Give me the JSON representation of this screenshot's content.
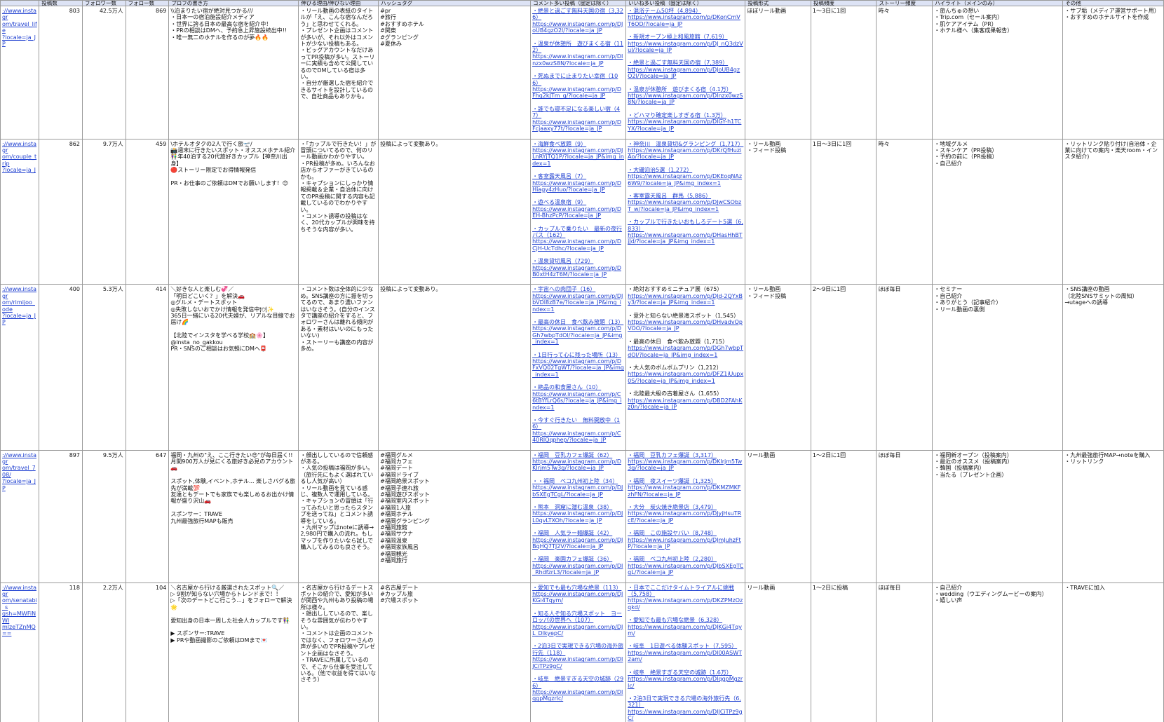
{
  "headers": [
    "",
    "投稿数",
    "フォロワー数",
    "フォロー数",
    "プロフの書き方",
    "伸びる理由/伸びない理由",
    "ハッシュタグ",
    "コメント多い投稿（固定は除く）",
    "いいね多い投稿（固定は除く）",
    "投稿形式",
    "投稿頻度",
    "ストーリー頻度",
    "ハイライト（メインのみ）",
    "その他"
  ],
  "rows": [
    {
      "url": "://www.instagr\nom/travel_life\n?locale=ja_JP",
      "posts": "803",
      "followers": "42.5万人",
      "following": "869",
      "profile": "\\\\泊まりたい宿が絶対見つかる///\n・日本一の宿泊施設紹介メディア\n・世界に誇る日本の最高な宿を紹介中！\n・PRの相談はDMへ、予約急上昇施設続出中!!\n・唯一無二のホテルを作るのが夢🔥🔥",
      "reason": "・リール動画の表紙のタイトルが「え、こんな宿なんだろう」と思わせてくれる。\n・プレゼント企画はコメントが多いが、それ以外はコメントが少ない投稿もある。\n・ビッグアカウントなだけあってPR投稿が多い。ストーリーに実績も含めて公開しているのでDMしている宿は多い。\n・自分が厳選した宿を紹介できるサイトを設計しているので、自社商品もありかも。",
      "hashtags": "#pr\n#旅行\n#おすすめホテル\n#関東\n#グランピング\n#夏休み",
      "comment_posts": [
        {
          "title": "・絶景と過ごす無料天国の宿（3,326）",
          "url": "https://www.instagram.com/p/DJoUB4gzO2l/?locale=ja_JP"
        },
        {
          "title": "・温泉が休憩所　遊びまくる宿（112）",
          "url": "https://www.instagram.com/p/DInzx0wzS8N/?locale=ja_JP"
        },
        {
          "title": "・死ぬまでに止まりたい幸宿（106）",
          "url": "https://www.instagram.com/p/DFhq2kJTm_g/?locale=ja_JP"
        },
        {
          "title": "・誰でも寝不足になる楽しい宿（47）",
          "url": "https://www.instagram.com/p/DFcjaaxy77t/?locale=ja_JP"
        }
      ],
      "like_posts": [
        {
          "title": "・混浴テーム50坪（4,894）",
          "url": "https://www.instagram.com/p/DKonCmVT6OD/?locale=ja_JP"
        },
        {
          "title": "・新規オープン極上和風旅館（7,619）",
          "url": "https://www.instagram.com/p/DJ_nQ3dzVul/?locale=ja_JP"
        },
        {
          "title": "・絶景と過ごす無料天国の宿（7,389）",
          "url": "https://www.instagram.com/p/DJoUB4gzO2l/?locale=ja_JP"
        },
        {
          "title": "・温泉が休憩所　遊びまくる宿（4.1万）",
          "url": "https://www.instagram.com/p/DInzx0wzS8N/?locale=ja_JP"
        },
        {
          "title": "・どハマり確定楽しすぎる宿（1.3万）",
          "url": "https://www.instagram.com/p/DIGY-h1TCYX/?locale=ja_JP"
        }
      ],
      "format": "ほぼリール動画",
      "frequency": "1〜3日に1回",
      "story": "時々",
      "highlight": "・旅んちゅの想い\n・Trip.com（セール案内）\n・肌ケアアイテム（PR）\n・ホテル様へ（集客成果報告）",
      "other": "・サブ垢（メディア運営サポート用）\n・おすすめのホテルサイトを作成"
    },
    {
      "url": "://www.instagr\nom/couple_trip\n?locale=ja_J",
      "posts": "862",
      "followers": "9.7万人",
      "following": "459",
      "profile": "\\ホテルオタクの2人で行く旅🛫/\n📸週末に行きたいスポット・オススメホテル紹介\n👫年40泊する20代旅好きカップル【神奈川出身】\n🔴ストーリー限定でお得情報発信\n\nPR・お仕事のご依頼はDMでお願いします！😊",
      "reason": "・「カップルで行きたい！」が冒頭についてるので、何のリール動画かわかりやすい。\n・PR投稿が多め。いろんなお店からオファーがきているのかも。\n・キャプションにしっかり情報掲載＆企業・自治体に向けてのPR投稿に関する内容も記載しているのでわかりやすい。\n・コメント誘導の投稿はなく、20代カップルが興味を持ちそうな内容が多い。",
      "hashtags": "投稿によって変動あり。",
      "comment_posts": [
        {
          "title": "・海鮮食べ放題（9）",
          "url": "https://www.instagram.com/p/DJLnRYjTQ1P/?locale=ja_JP&img_index=1"
        },
        {
          "title": "・客室露天風呂（7）",
          "url": "https://www.instagram.com/p/DHiagy4zHuo/?locale=ja_JP"
        },
        {
          "title": "・遊べる温泉宿（9）",
          "url": "https://www.instagram.com/p/DEH-BhzPcP/?locale=ja_JP"
        },
        {
          "title": "・カップルで乗りたい　最新の夜行バス（162）",
          "url": "https://www.instagram.com/p/DCjH-UcTdhc/?locale=ja_JP"
        },
        {
          "title": "・温泉貸切風呂（729）",
          "url": "https://www.instagram.com/p/DB0xtH4zT6M/?locale=ja_JP"
        }
      ],
      "like_posts": [
        {
          "title": "・神奈川　温泉貸切&グランピング（1,717）",
          "url": "https://www.instagram.com/p/DKrQfHuziAo/?locale=ja_JP"
        },
        {
          "title": "・大磯泊治5選（1,272）",
          "url": "https://www.instagram.com/p/DKEoqNAz6W9/?locale=ja_JP&img_index=1"
        },
        {
          "title": "・客室露天風呂　群馬（5,886）",
          "url": "https://www.instagram.com/p/DJwCSObzT_w/?locale=ja_JP&img_index=1"
        },
        {
          "title": "・カップルで行きたいおもしろデート5選（6,833）",
          "url": "https://www.instagram.com/p/DHasHhBTjJd/?locale=ja_JP&img_index=1"
        }
      ],
      "format": "・リール動画\n・フィード投稿",
      "frequency": "1日〜3日に1回",
      "story": "時々",
      "highlight": "・地域グルメ\n・スキンケア（PR投稿）\n・予約の前に（PR投稿）\n・自己紹介",
      "other": "・リットリンク貼り付け(自治体・企業に向けての案内・楽天room・インスタ紹介)"
    },
    {
      "url": "://www.instagr\nom/rimijoo_ode\n?locale=ja_JP",
      "posts": "400",
      "followers": "5.3万人",
      "following": "414",
      "profile": "＼好きな人と楽しむ💞／\n「明日どこいく？」を解決🚗\n◎グルメ・デートスポット\n◎失敗しないおでかけ情報を発信中🍽✨\n365日一緒にいる20代夫婦が、リアルな目線でお届け🌈\n\n【北陸でインスタを学べる学校🏫🌸】\n@insta_no_gakkou\nPR・SNSのご相談はお気軽にDMへ📮",
      "reason": "・コメント数は全体的に少なめ。SNS講座の方に振を切ってるので、あまり濃いファンはいなさそう。(自分のインスタで講座の紹介をすると、フォロワーさんは離れる傾向がある・素材はいいのにもったいない)\n・ストーリーも講座の内容が多め。",
      "hashtags": "投稿によって変動あり。",
      "comment_posts": [
        {
          "title": "・宇宙への肉団子（16）",
          "url": "https://www.instagram.com/p/DJbVDl8zB7e/?locale=ja_JP&img_index=1"
        },
        {
          "title": "・最高の休日　食べ飲み放題（13）",
          "url": "https://www.instagram.com/p/DGh7wbpTdOl/?locale=ja_JP&img_index=1"
        },
        {
          "title": "・1日行って心に残った場所（13）",
          "url": "https://www.instagram.com/p/DFxVQ02TgWT/?locale=ja_JP&img_index=1"
        },
        {
          "title": "・絶品の和食屋さん（10）",
          "url": "https://www.instagram.com/p/C6tBYfLrQ6s/?locale=ja_JP&img_index=1"
        },
        {
          "title": "・今すぐ行きたい　無料開放中（16）",
          "url": "https://www.instagram.com/p/C40RIQqphep/?locale=ja_JP"
        }
      ],
      "like_posts": [
        {
          "title": "・絶対おすすめミニチュア展（675）",
          "url": "https://www.instagram.com/p/DJd-2QYxBy3/?locale=ja_JP&img_index=1",
          "plain": true
        },
        {
          "title": "・意外と知らない絶景滝スポット（1,545）",
          "url": "https://www.instagram.com/p/DHvadvOpVOO/?locale=ja_JP",
          "plain": true
        },
        {
          "title": "・最高の休日　食べ飲み放題（1,715）",
          "url": "https://www.instagram.com/p/DGh7wbpTdOl/?locale=ja_JP&img_index=1",
          "plain": true
        },
        {
          "title": "・大人気のボムボムプリン（1,212）",
          "url": "https://www.instagram.com/p/DFZ1iUupx0S/?locale=ja_JP&img_index=1",
          "plain": true
        },
        {
          "title": "・北陸最大級の古着屋さん（1,655）",
          "url": "https://www.instagram.com/p/DBD2FAhKz0n/?locale=ja_JP",
          "plain": true
        }
      ],
      "format": "・リール動画\n・フィード投稿",
      "frequency": "2〜9日に1回",
      "story": "ほぼ毎日",
      "highlight": "・セミナー\n・自己紹介\n・ありがとう（記事紹介）\n・リール動画の裏側",
      "other": "・SNS講座の動画\n（北陸SNSサミットの周知）\n→utageへの誘導"
    },
    {
      "url": "://www.instagr\nom/travel_708/\n?locale=ja_JP",
      "posts": "897",
      "followers": "9.5万人",
      "following": "647",
      "profile": "福岡・九州の\"え、ここ行きたい😍\"が毎日届く!!\n月間900万人が見にくる旅好き必見のアカウント🚗\n\nスポット,体験,イベント,ホテル... 楽しさバグる旅先が満載💯\n友達ともデートでも家族でも楽しめるお出かけ情報が盛り沢山🚗\n\nスポンサー：TRAVE\n九州最強旅行MAPも販売",
      "reason": "・顔出ししているので信頼感がある。\n・人気の投稿は福岡が多い。（旅行先にもよく選ばれているし人気が高い）\n・リール動画を見ている感じ、複数人で運用している。\n・キャプションの冒頭は「行ってみたいと思ったらスタンプを送ってね」とコメント誘導をしている。\n・九州マップはnoteに誘導→2,980円で購入の流れ。もしマップを作りたいなら試しで購入してみるのも良さそう。",
      "hashtags": "#福岡グルメ\n#福岡カフェ\n#福岡デート\n#福岡ドライブ\n#福岡絶景スポット\n#福岡子連れ旅\n#福岡遊びスポット\n#福岡室内スポット\n#福岡1人旅\n#福岡ホテル\n#福岡グランピング\n#福岡旅館\n#福岡サウナ\n#福岡温泉\n#福岡家族風呂\n#福岡観光\n#福岡旅行",
      "comment_posts": [
        {
          "title": "・福岡　豆乳カフェ爆誕（62）",
          "url": "https://www.instagram.com/p/DKIrjm5Tw3g/?locale=ja_JP"
        },
        {
          "title": "・・福岡　ペコ九州初上陸（34）",
          "url": "https://www.instagram.com/p/DJbSXEgTCgL/?locale=ja_JP"
        },
        {
          "title": "・熊本　洞窟に潜む温泉（38）",
          "url": "https://www.instagram.com/p/DJL0qvLTXOh/?locale=ja_JP"
        },
        {
          "title": "・福岡　人気ラー麺爆誕（42）",
          "url": "https://www.instagram.com/p/DJBqHQ7TJ2V/?locale=ja_JP"
        },
        {
          "title": "・福岡　楽園カフェ爆誕（36）",
          "url": "https://www.instagram.com/p/DI_RhdfzrL3/?locale=ja_JP"
        }
      ],
      "like_posts": [
        {
          "title": "・福岡　豆乳カフェ爆誕（3,317）",
          "url": "https://www.instagram.com/p/DKIrjm5Tw3g/?locale=ja_JP"
        },
        {
          "title": "・福岡　夜スイーツ爆誕（1,325）",
          "url": "https://www.instagram.com/p/DKMZMKFzhFN/?locale=ja_JP"
        },
        {
          "title": "・大分　炭火焼き絶景店（3,479）",
          "url": "https://www.instagram.com/p/DJyjHsuTRcE/?locale=ja_JP"
        },
        {
          "title": "・福岡　この施設ヤバい（8,748）",
          "url": "https://www.instagram.com/p/DJmJuhzFtP/?locale=ja_JP"
        },
        {
          "title": "・福岡　ペコ九州初上陸（2,280）",
          "url": "https://www.instagram.com/p/DJbSXEgTCgL/?locale=ja_JP"
        }
      ],
      "format": "リール動画",
      "frequency": "1〜2日に1回",
      "story": "ほぼ毎日",
      "highlight": "・福岡新オープン（投稿案内）\n・最近のオススメ（投稿案内）\n・韓国（投稿案内）\n・当たる（プレゼント企画）",
      "other": "・九州最強旅行MAP→noteを購入\n・リットリンク"
    },
    {
      "url": "://www.instagr\nom/senatabi_s\ngsh=MWFiNWI\nmlzeTZnMQ==",
      "posts": "118",
      "followers": "2.2万人",
      "following": "104",
      "profile": "＼名古屋から行ける厳選されたスポット🔍／\n▷ 9割が知らない穴場からトレンドまで！！\n▷「次のデートどこ行こう...」をフォローで解決🌟\n\n愛知出身の日本一周した社会人カップルです👫\n\n▶ スポンサー:TRAVE\n▶ PRや動画撮影のご依頼はDMまで💌",
      "reason": "・名古屋から行けるデートスポットの紹介で、愛知が多いが関西や九州もあり投稿の場所は様々。\n・顔出ししているので、楽しそうな雰囲気が伝わりやすい。\n・コメントは企画のコメントではなく、フォロワーさんの声が多いのでPR投稿やプレゼント企画はなさそう。\n・TRAVEに所属しているので、そこから仕事を受注している。（他で収益を得てはいなさそう）",
      "hashtags": "#名古屋デート\n#カップル旅\n#穴場スポット",
      "comment_posts": [
        {
          "title": "・愛知でも最も穴場な絶景（113）",
          "url": "https://www.instagram.com/p/DJKGi4Tqym/"
        },
        {
          "title": "・知る人ぞ知る穴場スポット　ヨーロッパの世界へ（107）",
          "url": "https://www.instagram.com/p/DJL_DlkyepC/"
        },
        {
          "title": "・2泊3日で実現できる穴場の海外旅行先（118）",
          "url": "https://www.instagram.com/p/DIJCiTPz9gC/"
        },
        {
          "title": "・岐阜　絶景すぎる天空の城跡（296）",
          "url": "https://www.instagram.com/p/DIqgpMgzrlc/"
        }
      ],
      "like_posts": [
        {
          "title": "・日本でここだけタイムトライアルに挑戦（5,758）",
          "url": "https://www.instagram.com/p/DKZPMzOzqkd/"
        },
        {
          "title": "・愛知でも最も穴場な絶景（6,328）",
          "url": "https://www.instagram.com/p/DJKGi4Tqym/"
        },
        {
          "title": "・岐阜　1日遊べる体験スポット（7,595）",
          "url": "https://www.instagram.com/p/DI00ASWT2am/"
        },
        {
          "title": "・岐阜　絶景すぎる天空の城跡（1.6万）",
          "url": "https://www.instagram.com/p/DIqgpMgzrlc/"
        },
        {
          "title": "・2泊3日で実現できる穴場の海外旅行先（6,321）",
          "url": "https://www.instagram.com/p/DIJCiTPz9gC/"
        }
      ],
      "format": "リール動画",
      "frequency": "1〜2日に投稿",
      "story": "ほぼ毎日",
      "highlight": "・自己紹介\n・wedding（ウエディングムービーの案内）\n・嬉しい声",
      "other": "・TRAVEに加入"
    }
  ],
  "colors": {
    "header_bg": "#dde3f5",
    "link": "#1e3fd0",
    "grid": "#9a9a9a"
  }
}
